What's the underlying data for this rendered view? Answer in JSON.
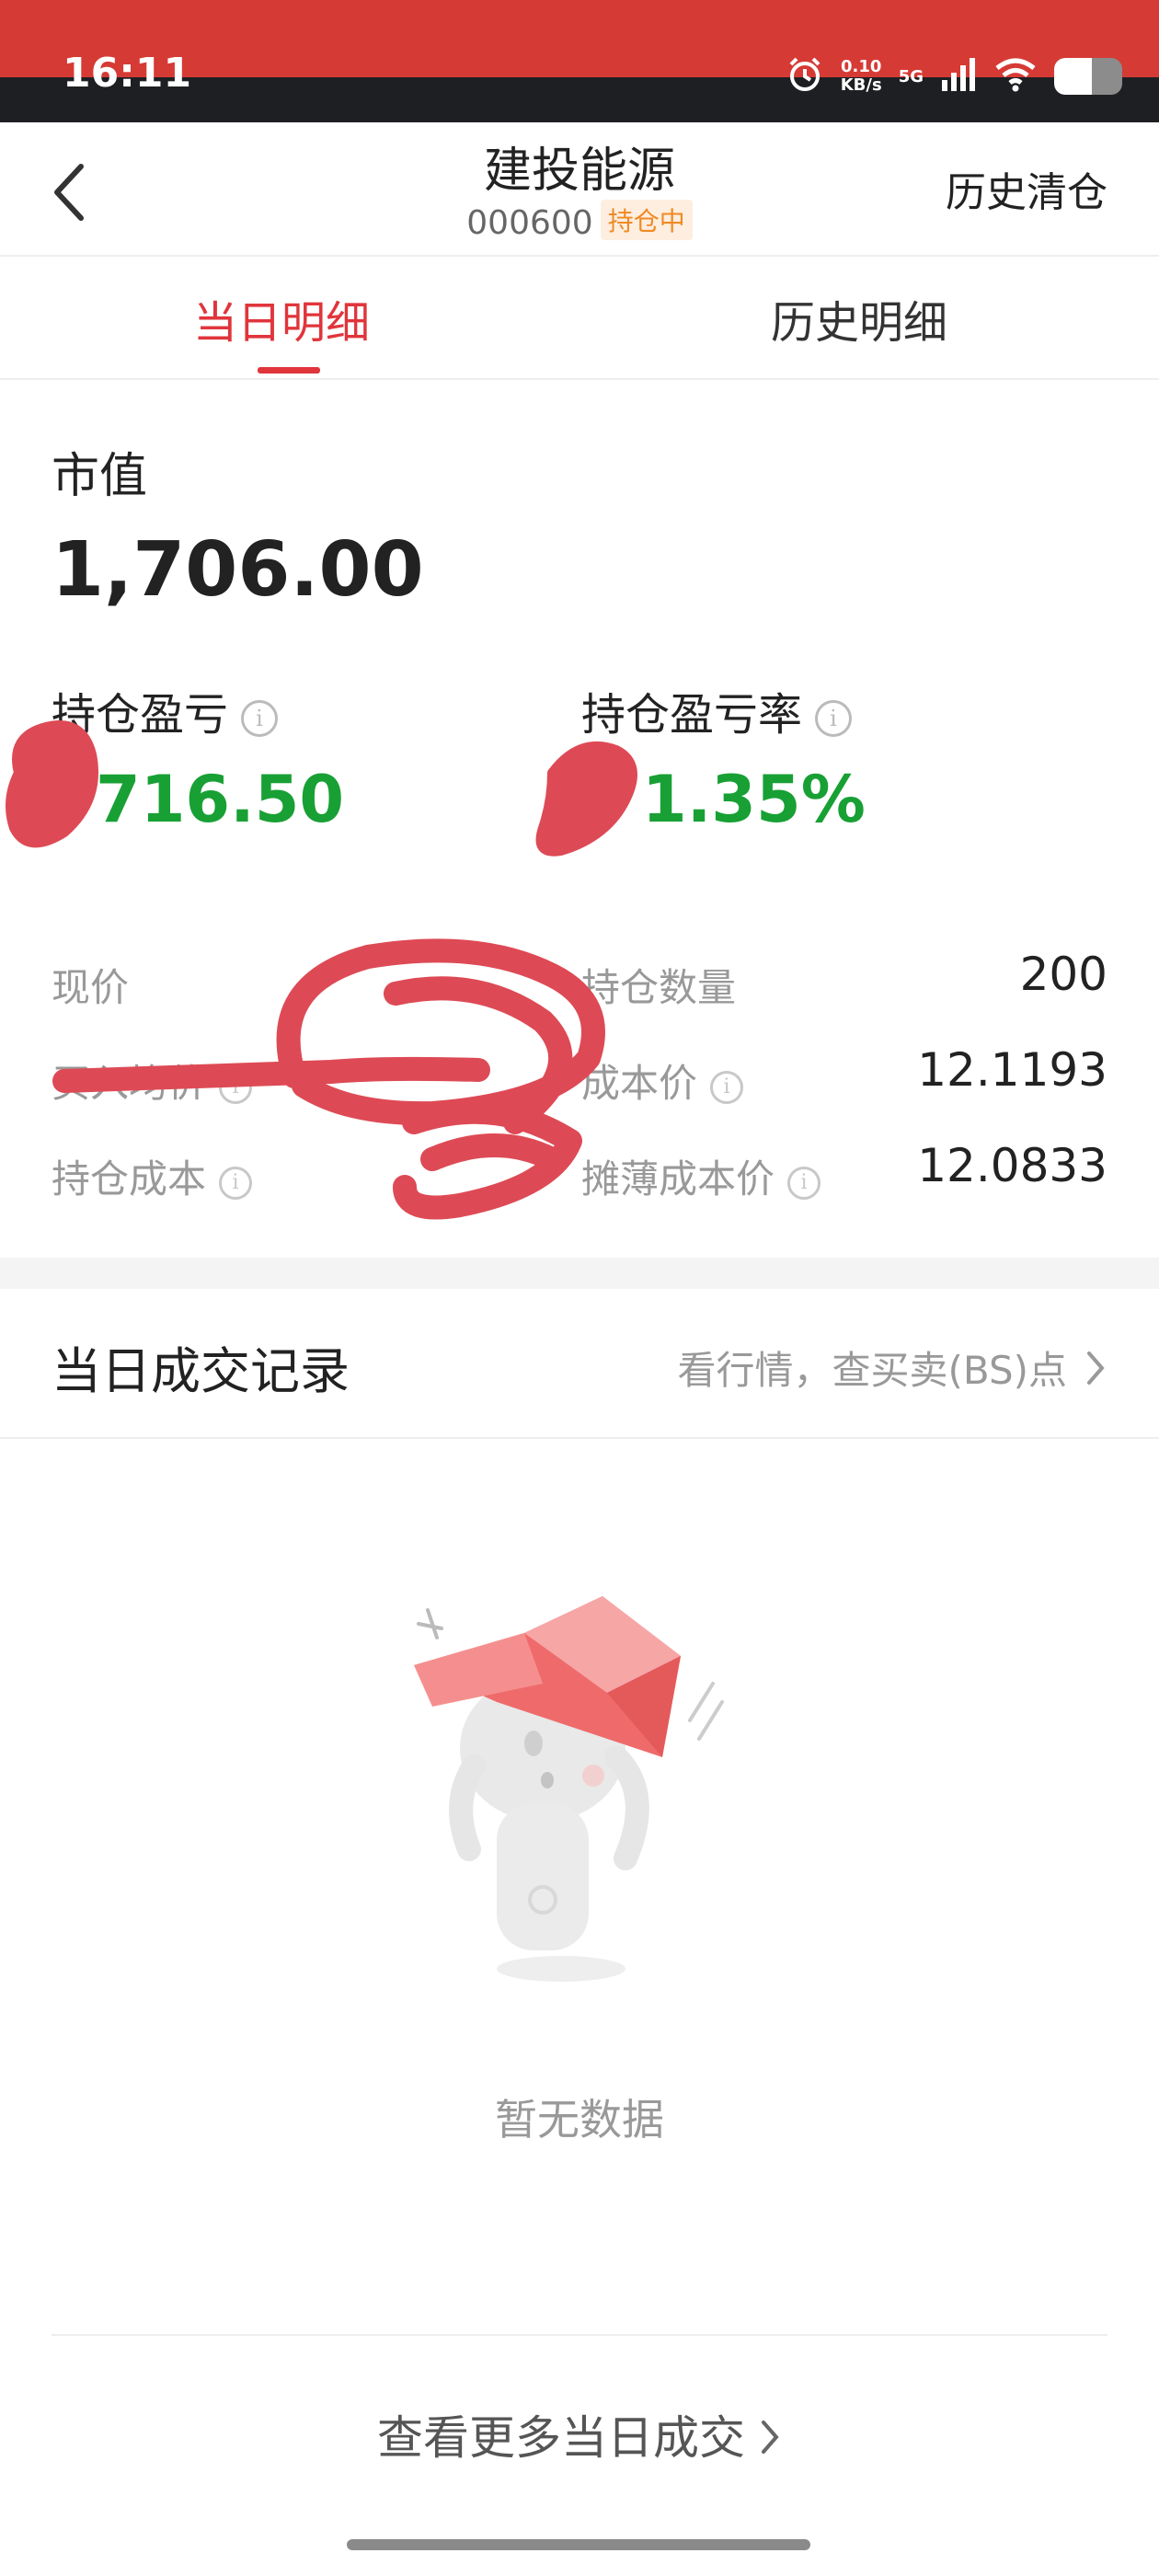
{
  "status_bar": {
    "time": "16:11",
    "net_speed_value": "0.10",
    "net_speed_unit": "KB/s",
    "network": "5G",
    "icons": [
      "alarm-icon",
      "signal-icon",
      "wifi-icon",
      "battery-icon"
    ]
  },
  "header": {
    "title": "建投能源",
    "code": "000600",
    "status_badge": "持仓中",
    "right_action": "历史清仓"
  },
  "tabs": [
    {
      "label": "当日明细",
      "active": true
    },
    {
      "label": "历史明细",
      "active": false
    }
  ],
  "overview": {
    "market_value_label": "市值",
    "market_value": "1,706.00",
    "pl_label": "持仓盈亏",
    "pl_value": "716.50",
    "pl_rate_label": "持仓盈亏率",
    "pl_rate_value": "1.35%"
  },
  "details": {
    "current_price_label": "现价",
    "buy_avg_label": "买入均价",
    "position_cost_label": "持仓成本",
    "quantity_label": "持仓数量",
    "quantity_value": "200",
    "cost_price_label": "成本价",
    "cost_price_value": "12.1193",
    "diluted_cost_label": "摊薄成本价",
    "diluted_cost_value": "12.0833"
  },
  "records": {
    "title": "当日成交记录",
    "link": "看行情，查买卖(BS)点",
    "empty_text": "暂无数据",
    "more_link": "查看更多当日成交"
  },
  "colors": {
    "accent_red": "#e0353b",
    "profit_green": "#18a034",
    "badge_orange": "#f08a24",
    "status_red": "#d63a35"
  }
}
